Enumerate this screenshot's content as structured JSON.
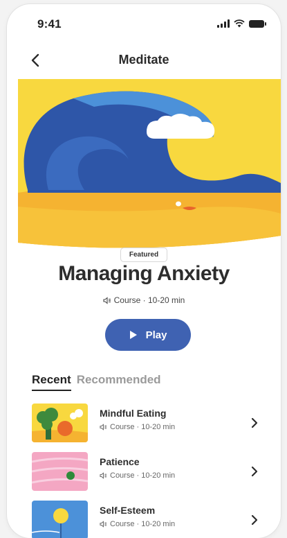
{
  "status_bar": {
    "time": "9:41"
  },
  "header": {
    "title": "Meditate"
  },
  "featured": {
    "badge": "Featured",
    "title": "Managing Anxiety",
    "meta": "Course · 10-20 min",
    "play_label": "Play"
  },
  "tabs": [
    {
      "label": "Recent",
      "active": true
    },
    {
      "label": "Recommended",
      "active": false
    }
  ],
  "list": [
    {
      "title": "Mindful Eating",
      "meta": "Course · 10-20 min"
    },
    {
      "title": "Patience",
      "meta": "Course · 10-20 min"
    },
    {
      "title": "Self-Esteem",
      "meta": "Course · 10-20 min"
    }
  ],
  "colors": {
    "accent": "#3f62b2",
    "hero_yellow": "#f8d83f",
    "hero_blue": "#2e56a8",
    "hero_orange": "#f5b331"
  },
  "icons": [
    "signal-icon",
    "wifi-icon",
    "battery-icon",
    "back-chevron-icon",
    "speaker-icon",
    "play-icon",
    "chevron-right-icon"
  ]
}
